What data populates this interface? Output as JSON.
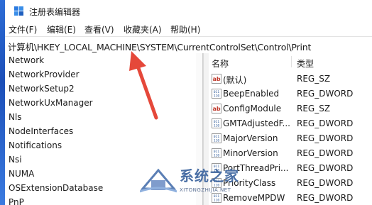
{
  "window": {
    "title": "注册表编辑器"
  },
  "menu": [
    "文件(F)",
    "编辑(E)",
    "查看(V)",
    "收藏夹(A)",
    "帮助(H)"
  ],
  "address": "计算机\\HKEY_LOCAL_MACHINE\\SYSTEM\\CurrentControlSet\\Control\\Print",
  "tree": {
    "items": [
      "Network",
      "NetworkProvider",
      "NetworkSetup2",
      "NetworkUxManager",
      "Nls",
      "NodeInterfaces",
      "Notifications",
      "Nsi",
      "NUMA",
      "OSExtensionDatabase",
      "PnP"
    ]
  },
  "list": {
    "headers": {
      "name": "名称",
      "type": "类型"
    },
    "rows": [
      {
        "name": "(默认)",
        "type": "REG_SZ",
        "icon": "string-value-icon"
      },
      {
        "name": "BeepEnabled",
        "type": "REG_DWORD",
        "icon": "binary-value-icon"
      },
      {
        "name": "ConfigModule",
        "type": "REG_SZ",
        "icon": "string-value-icon"
      },
      {
        "name": "GMTAdjustedF...",
        "type": "REG_DWORD",
        "icon": "binary-value-icon"
      },
      {
        "name": "MajorVersion",
        "type": "REG_DWORD",
        "icon": "binary-value-icon"
      },
      {
        "name": "MinorVersion",
        "type": "REG_DWORD",
        "icon": "binary-value-icon"
      },
      {
        "name": "PortThreadPri...",
        "type": "REG_DWORD",
        "icon": "binary-value-icon"
      },
      {
        "name": "PriorityClass",
        "type": "REG_DWORD",
        "icon": "binary-value-icon"
      },
      {
        "name": "RemoveMPDW",
        "type": "REG_DWORD",
        "icon": "binary-value-icon"
      }
    ]
  },
  "watermark": {
    "title": "系统之家",
    "subtitle": "XITONGZHIJIA.NET"
  },
  "colors": {
    "arrow": "#e5483a",
    "window_edge": "#1c4fb8",
    "string_icon": "#c0392b",
    "binary_icon": "#2b5797"
  }
}
